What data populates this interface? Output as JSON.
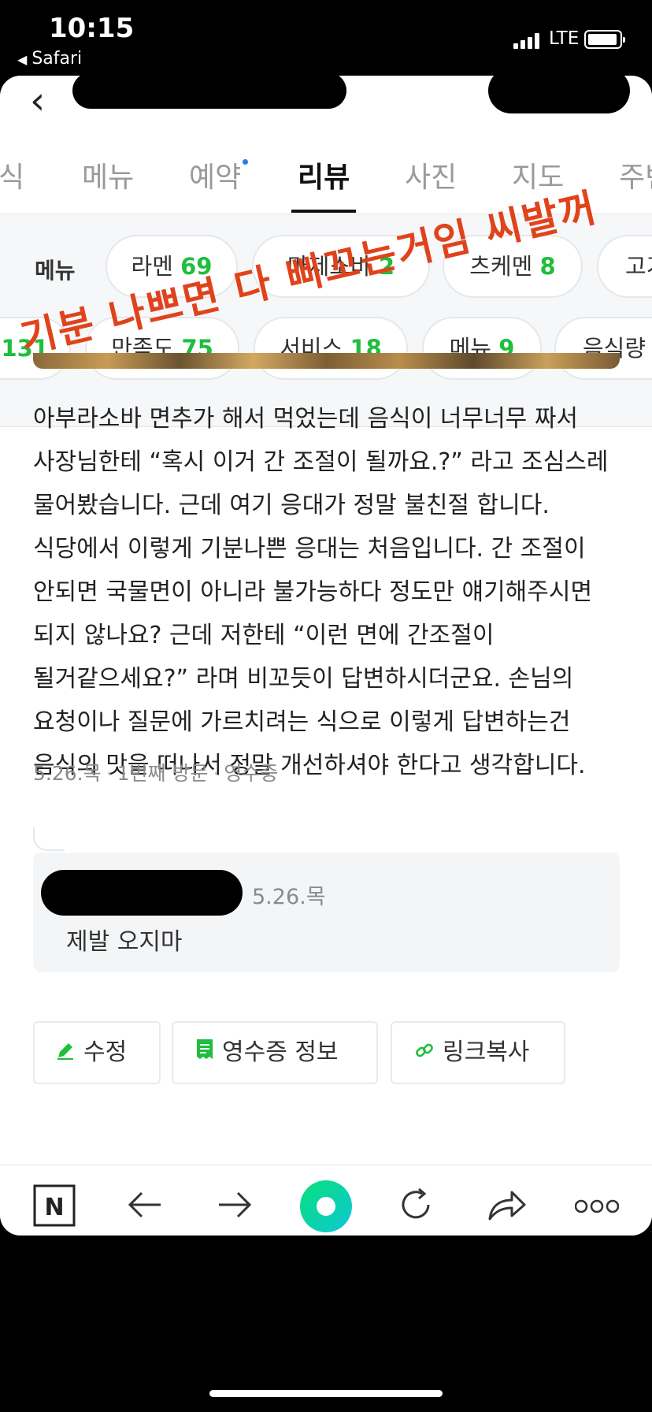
{
  "status_bar": {
    "time": "10:15",
    "back_app": "Safari",
    "network": "LTE"
  },
  "tabs": [
    {
      "label": "식",
      "active": false
    },
    {
      "label": "메뉴",
      "active": false
    },
    {
      "label": "예약",
      "active": false,
      "dot": true
    },
    {
      "label": "리뷰",
      "active": true
    },
    {
      "label": "사진",
      "active": false
    },
    {
      "label": "지도",
      "active": false
    },
    {
      "label": "주변",
      "active": false
    }
  ],
  "filters": {
    "label": "메뉴",
    "row1": [
      {
        "name": "라멘",
        "count": "69"
      },
      {
        "name": "마제소바",
        "count": "2"
      },
      {
        "name": "츠케멘",
        "count": "8"
      },
      {
        "name": "고기",
        "count": ""
      }
    ],
    "row2": [
      {
        "name": "",
        "count": "131"
      },
      {
        "name": "만족도",
        "count": "75"
      },
      {
        "name": "서비스",
        "count": "18"
      },
      {
        "name": "메뉴",
        "count": "9"
      },
      {
        "name": "음식량",
        "count": ""
      }
    ]
  },
  "review": {
    "body": "아부라소바 면추가 해서 먹었는데 음식이 너무너무 짜서 사장님한테 “혹시 이거 간 조절이 될까요.?” 라고 조심스레 물어봤습니다. 근데 여기 응대가 정말 불친절 합니다. 식당에서 이렇게 기분나쁜 응대는 처음입니다. 간 조절이 안되면 국물면이 아니라 불가능하다 정도만 얘기해주시면 되지 않나요? 근데 저한테 “이런 면에 간조절이 될거같으세요?” 라며 비꼬듯이 답변하시더군요. 손님의 요청이나 질문에 가르치려는 식으로 이렇게 답변하는건 음식의 맛을 떠나서 정말 개선하셔야 한다고 생각합니다.",
    "date": "5.26.목",
    "visit": "1번째 방문",
    "receipt": "영수증"
  },
  "reply": {
    "date": "5.26.목",
    "text": "제발 오지마"
  },
  "actions": {
    "edit": "수정",
    "receipt_info": "영수증 정보",
    "copy_link": "링크복사"
  },
  "overlay": "기분 나쁘면 다 삐꼬는거임 씨발꺼",
  "colors": {
    "accent_green": "#1fbe3c",
    "overlay_red": "#e0431b",
    "tab_dot": "#2e7bf0"
  }
}
